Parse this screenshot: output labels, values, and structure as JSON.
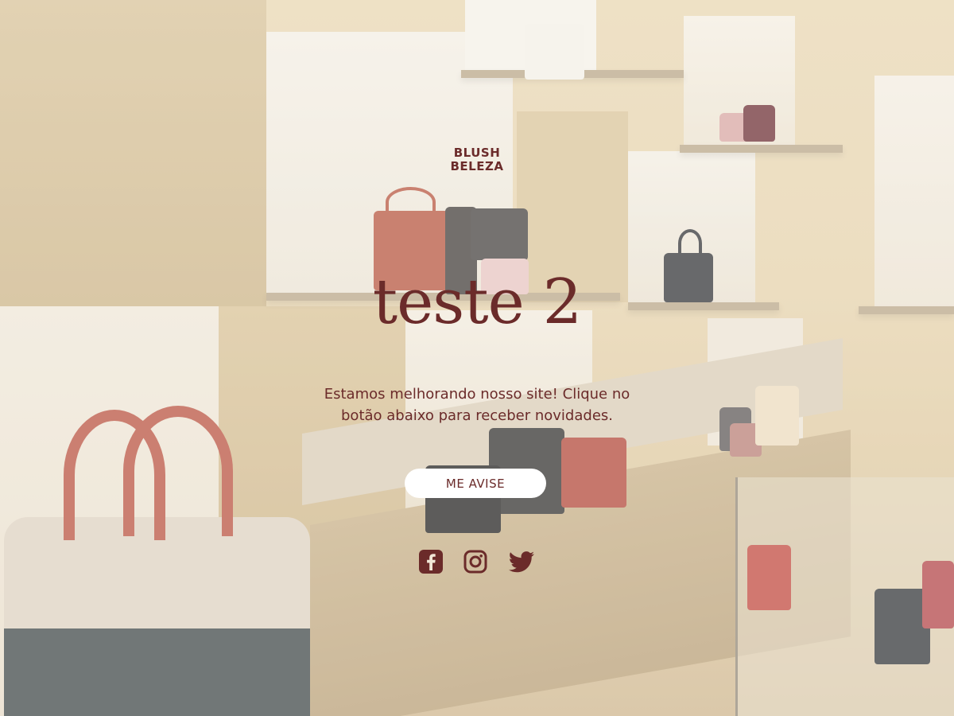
{
  "page": {
    "brand_line1": "BLUSH",
    "brand_line2": "BELEZA",
    "title": "teste 2",
    "message": "Estamos melhorando nosso site! Clique no botão abaixo para receber novidades.",
    "cta_label": "ME AVISE"
  },
  "social": [
    {
      "name": "facebook"
    },
    {
      "name": "instagram"
    },
    {
      "name": "twitter"
    }
  ],
  "colors": {
    "text": "#6b2b2a",
    "button_bg": "#ffffff"
  }
}
